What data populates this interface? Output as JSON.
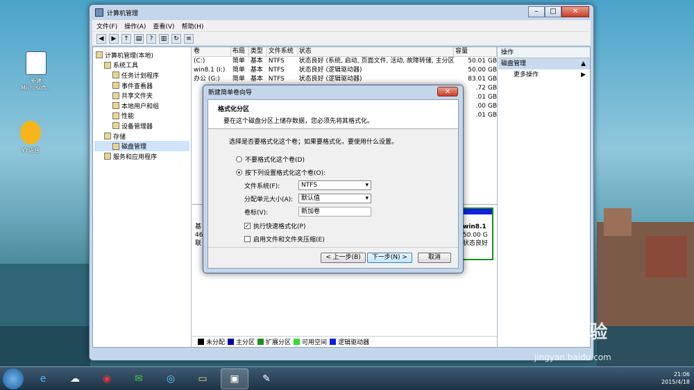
{
  "desktop": {
    "icons": [
      {
        "label": "新建\nMicrosoft..."
      },
      {
        "label": "YY语音"
      }
    ]
  },
  "window": {
    "title": "计算机管理",
    "controls": {
      "minimize": "–",
      "maximize": "□",
      "close": "✕"
    },
    "menu": [
      "文件(F)",
      "操作(A)",
      "查看(V)",
      "帮助(H)"
    ],
    "tree": [
      {
        "label": "计算机管理(本地)",
        "indent": 0
      },
      {
        "label": "系统工具",
        "indent": 1
      },
      {
        "label": "任务计划程序",
        "indent": 2
      },
      {
        "label": "事件查看器",
        "indent": 2
      },
      {
        "label": "共享文件夹",
        "indent": 2
      },
      {
        "label": "本地用户和组",
        "indent": 2
      },
      {
        "label": "性能",
        "indent": 2
      },
      {
        "label": "设备管理器",
        "indent": 2
      },
      {
        "label": "存储",
        "indent": 1
      },
      {
        "label": "磁盘管理",
        "indent": 2,
        "selected": true
      },
      {
        "label": "服务和应用程序",
        "indent": 1
      }
    ],
    "volume_columns": [
      "卷",
      "布局",
      "类型",
      "文件系统",
      "状态",
      "容量"
    ],
    "volumes": [
      {
        "vol": "(C:)",
        "layout": "简单",
        "type": "基本",
        "fs": "NTFS",
        "status": "状态良好 (系统, 启动, 页面文件, 活动, 故障转储, 主分区)",
        "cap": "50.01 GB"
      },
      {
        "vol": "win8.1 (I:)",
        "layout": "简单",
        "type": "基本",
        "fs": "NTFS",
        "status": "状态良好 (逻辑驱动器)",
        "cap": "50.00 GB"
      },
      {
        "vol": "办公 (G:)",
        "layout": "简单",
        "type": "基本",
        "fs": "NTFS",
        "status": "状态良好 (逻辑驱动器)",
        "cap": "83.01 GB"
      },
      {
        "vol": "",
        "layout": "",
        "type": "",
        "fs": "",
        "status": "",
        "cap": ".72 GB"
      },
      {
        "vol": "",
        "layout": "",
        "type": "",
        "fs": "",
        "status": "",
        "cap": ".01 GB"
      },
      {
        "vol": "",
        "layout": "",
        "type": "",
        "fs": "",
        "status": "",
        "cap": ".00 GB"
      },
      {
        "vol": "",
        "layout": "",
        "type": "",
        "fs": "",
        "status": "",
        "cap": ".01 GB"
      }
    ],
    "disk_partial": {
      "left1": "基",
      "left2": "46",
      "left3": "联",
      "right1": "win8.1",
      "right2": "50.00 G",
      "right3": "状态良好"
    },
    "legend": [
      {
        "label": "未分配",
        "color": "#000000"
      },
      {
        "label": "主分区",
        "color": "#0000a8"
      },
      {
        "label": "扩展分区",
        "color": "#1e8f1e"
      },
      {
        "label": "可用空间",
        "color": "#33dd33"
      },
      {
        "label": "逻辑驱动器",
        "color": "#1020e0"
      }
    ],
    "actions": {
      "header": "操作",
      "section": "磁盘管理",
      "more": "更多操作"
    }
  },
  "dialog": {
    "title": "新建简单卷向导",
    "close": "✕",
    "heading": "格式化分区",
    "subheading": "要在这个磁盘分区上储存数据，您必须先将其格式化。",
    "prompt": "选择是否要格式化这个卷；如果要格式化，要使用什么设置。",
    "option_no": "不要格式化这个卷(D)",
    "option_yes": "按下列设置格式化这个卷(O):",
    "fs_label": "文件系统(F):",
    "fs_value": "NTFS",
    "alloc_label": "分配单元大小(A):",
    "alloc_value": "默认值",
    "vol_label": "卷标(V):",
    "vol_value": "新加卷",
    "quick_format": "执行快速格式化(P)",
    "compress": "启用文件和文件夹压缩(E)",
    "back": "< 上一步(B)",
    "next": "下一步(N) >",
    "cancel": "取消"
  },
  "taskbar": {
    "time": "21:06",
    "date": "2015/4/18"
  },
  "watermark": {
    "line1": "Bai 经验",
    "line2": "jingyan.baidu.com"
  }
}
